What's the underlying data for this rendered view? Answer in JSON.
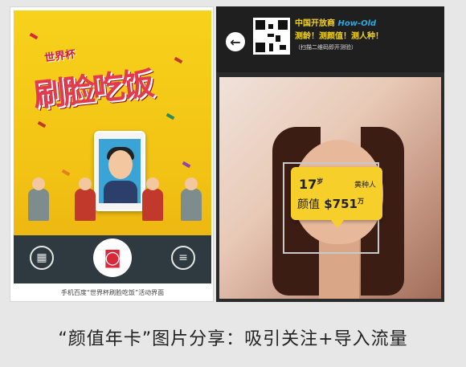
{
  "left_screen": {
    "small_title": "世界杯",
    "main_title": "刷脸吃饭",
    "caption": "手机百度“世界杯刷脸吃饭”活动界面",
    "icons": [
      "gallery-icon",
      "camera-icon",
      "menu-icon"
    ]
  },
  "right_screen": {
    "promo_line1_a": "中国开放商",
    "promo_line1_b": "How-Old",
    "promo_line2": "测龄！测颜值！测人种！",
    "promo_line3": "（扫描二维码即开测验）",
    "result": {
      "age_value": "17",
      "age_unit": "岁",
      "race": "黄种人",
      "score_label": "颜值",
      "score_value": "$751",
      "score_unit": "万"
    }
  },
  "caption": "“颜值年卡”图片分享：吸引关注+导入流量",
  "colors": {
    "poster_yellow": "#f2c214",
    "title_red": "#e23a4f",
    "badge_yellow": "#f7cf2a",
    "dark_bar": "#2f3a40"
  }
}
